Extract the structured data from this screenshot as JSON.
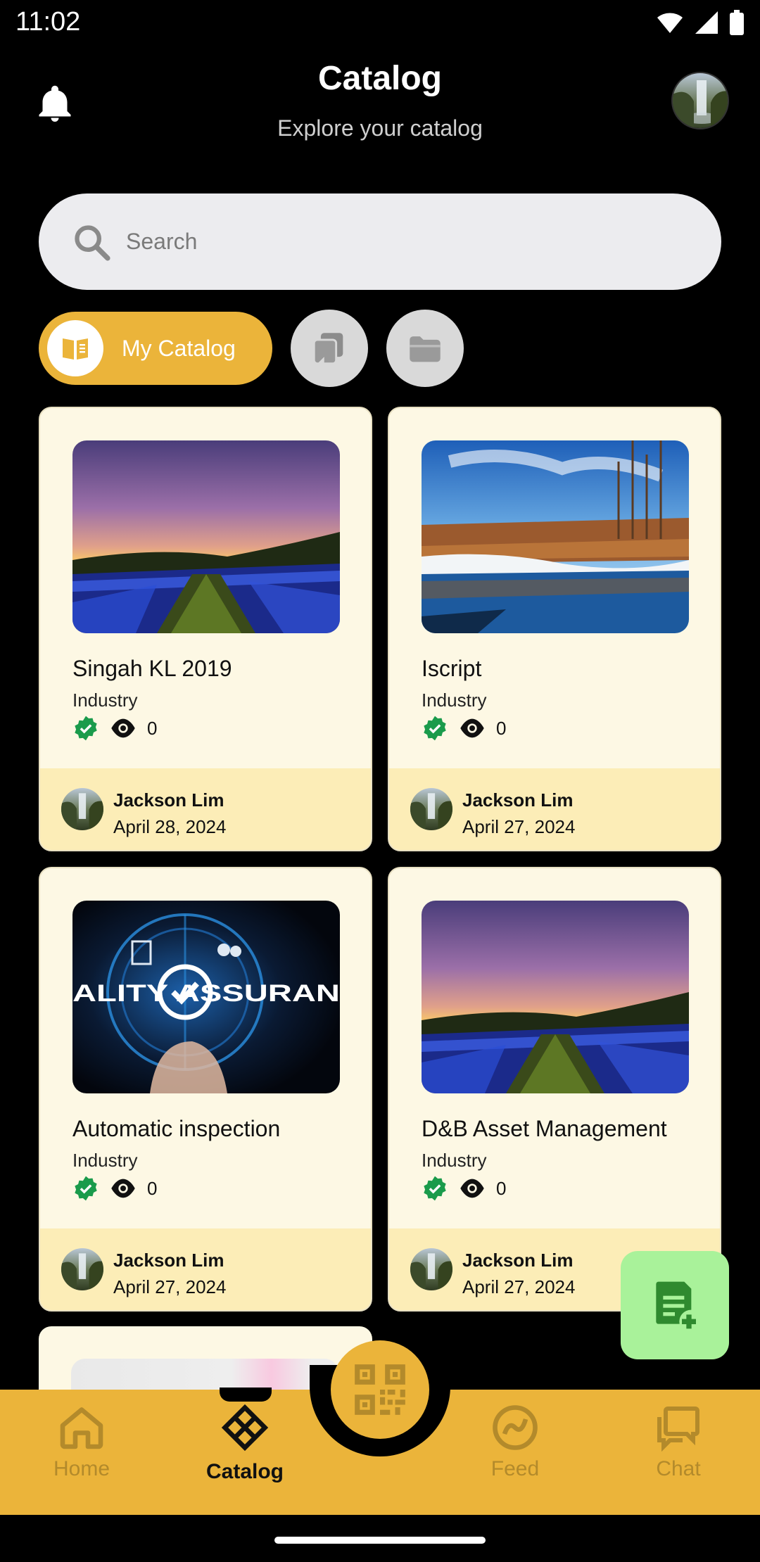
{
  "status_bar": {
    "time": "11:02"
  },
  "header": {
    "title": "Catalog",
    "subtitle": "Explore your catalog"
  },
  "search": {
    "placeholder": "Search"
  },
  "filters": {
    "active_label": "My Catalog"
  },
  "cards": [
    {
      "title": "Singah KL 2019",
      "category": "Industry",
      "views": "0",
      "author": "Jackson Lim",
      "date": "April 28, 2024",
      "image": "night-field"
    },
    {
      "title": "Iscript",
      "category": "Industry",
      "views": "0",
      "author": "Jackson Lim",
      "date": "April 27, 2024",
      "image": "winter-river"
    },
    {
      "title": "Automatic inspection",
      "category": "Industry",
      "views": "0",
      "author": "Jackson Lim",
      "date": "April 27, 2024",
      "image": "quality-assurance",
      "image_text": "ALITY ASSURAN"
    },
    {
      "title": "D&B Asset Management",
      "category": "Industry",
      "views": "0",
      "author": "Jackson Lim",
      "date": "April 27, 2024",
      "image": "night-field"
    }
  ],
  "bottom_nav": {
    "items": [
      {
        "label": "Home",
        "icon": "home-icon"
      },
      {
        "label": "Catalog",
        "icon": "catalog-icon",
        "active": true
      },
      {
        "label": "Feed",
        "icon": "feed-icon"
      },
      {
        "label": "Chat",
        "icon": "chat-icon"
      }
    ]
  },
  "colors": {
    "accent": "#ebb43a",
    "card_bg": "#fdf8e4",
    "card_footer": "#fcedb7",
    "fab": "#a9f29a",
    "verified": "#1a9b4b"
  }
}
